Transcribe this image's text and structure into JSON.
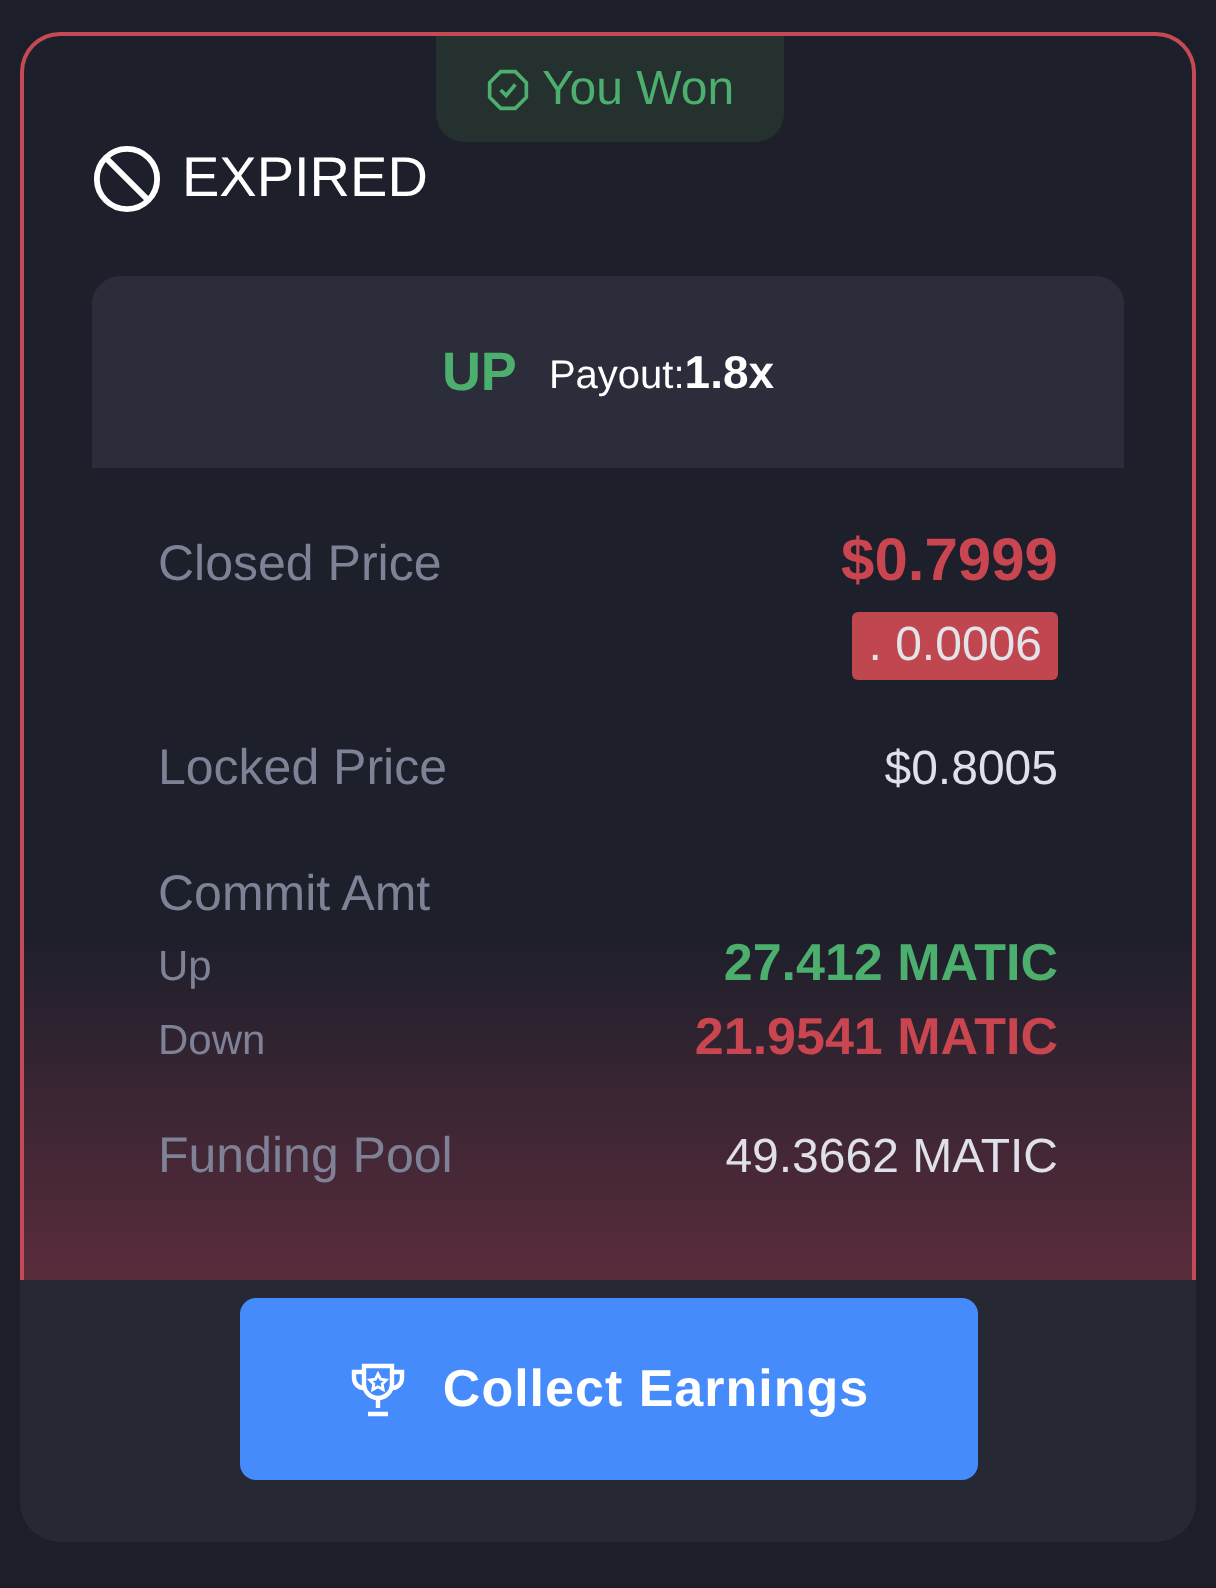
{
  "result_badge": "You Won",
  "status": "EXPIRED",
  "position": {
    "direction": "UP",
    "payout_label": "Payout:",
    "payout_value": "1.8x"
  },
  "closed_price": {
    "label": "Closed Price",
    "value": "$0.7999",
    "change": ". 0.0006"
  },
  "locked_price": {
    "label": "Locked Price",
    "value": "$0.8005"
  },
  "commit": {
    "label": "Commit Amt",
    "items": [
      {
        "label": "Up",
        "value": "27.412 MATIC",
        "color": "#4caf6e"
      },
      {
        "label": "Down",
        "value": "21.9541 MATIC",
        "color": "#c94550"
      }
    ]
  },
  "funding_pool": {
    "label": "Funding Pool",
    "value": "49.3662 MATIC"
  },
  "action_button": "Collect Earnings"
}
